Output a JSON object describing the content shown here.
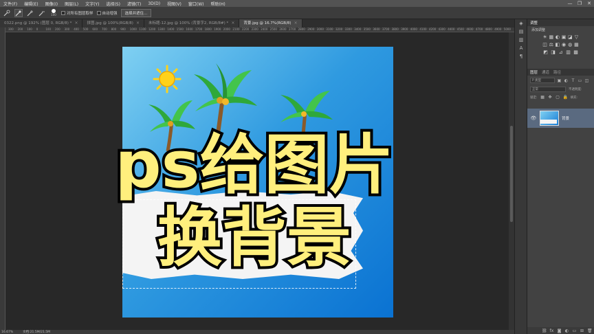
{
  "menu": {
    "items": [
      "文件(F)",
      "编辑(E)",
      "图像(I)",
      "图层(L)",
      "文字(Y)",
      "选择(S)",
      "滤镜(T)",
      "3D(D)",
      "视图(V)",
      "窗口(W)",
      "帮助(H)"
    ]
  },
  "window_controls": {
    "minimize": "—",
    "restore": "❐",
    "close": "✕"
  },
  "options": {
    "brush_size": "100",
    "sample_all_layers": "对所有图层取样",
    "auto_enhance": "自动增强",
    "select_subject": "选择并遮住..."
  },
  "tabs": [
    {
      "label": "0322.png @ 192% (图层 0, RGB/8) *"
    },
    {
      "label": "拼图.jpg @ 100%(RGB/8)"
    },
    {
      "label": "未标题-12.jpg @ 100% (背景字2, RGB/8#) *"
    },
    {
      "label": "背景.jpg @ 16.7%(RGB/8)"
    }
  ],
  "tab_close": "×",
  "ruler": {
    "top_ticks": [
      "300",
      "200",
      "100",
      "0",
      "100",
      "200",
      "300",
      "400",
      "500",
      "600",
      "700",
      "800",
      "900",
      "1000",
      "1100",
      "1200",
      "1300",
      "1400",
      "1500",
      "1600",
      "1700",
      "1800",
      "1900",
      "2000",
      "2100",
      "2200",
      "2300",
      "2400",
      "2500",
      "2600",
      "2700",
      "2800",
      "2900",
      "3000",
      "3100",
      "3200",
      "3300",
      "3400",
      "3500",
      "3600",
      "3700",
      "3800",
      "3900",
      "4000",
      "4100",
      "4200",
      "4300",
      "4400",
      "4500",
      "4600",
      "4700",
      "4800",
      "4900",
      "5000"
    ]
  },
  "overlay": {
    "line1": "ps给图片",
    "line2": "换背景"
  },
  "status": {
    "zoom": "16.67%",
    "doc_size": "文档:21.5M/21.5M"
  },
  "adjustments": {
    "header": "调整",
    "subtitle": "添加调整",
    "row1": [
      "☀",
      "▦",
      "◐",
      "▣",
      "◪",
      "▽"
    ],
    "row2": [
      "◫",
      "⚖",
      "◧",
      "◉",
      "◍",
      "▦"
    ],
    "row3": [
      "◩",
      "◨",
      "⊿",
      "▥",
      "▩"
    ]
  },
  "layers": {
    "tabs": [
      "图层",
      "通道",
      "路径"
    ],
    "search_placeholder": "P 类型",
    "blend_mode": "正常",
    "opacity_label": "不透明度:",
    "lock_label": "锁定:",
    "fill_label": "填充:",
    "layer_name": "背景",
    "eye": "👁"
  },
  "colors": {
    "accent_text": "#ffef7d",
    "panel": "#424242",
    "sky_light": "#7fd0f2",
    "sky_dark": "#0a72d2"
  }
}
